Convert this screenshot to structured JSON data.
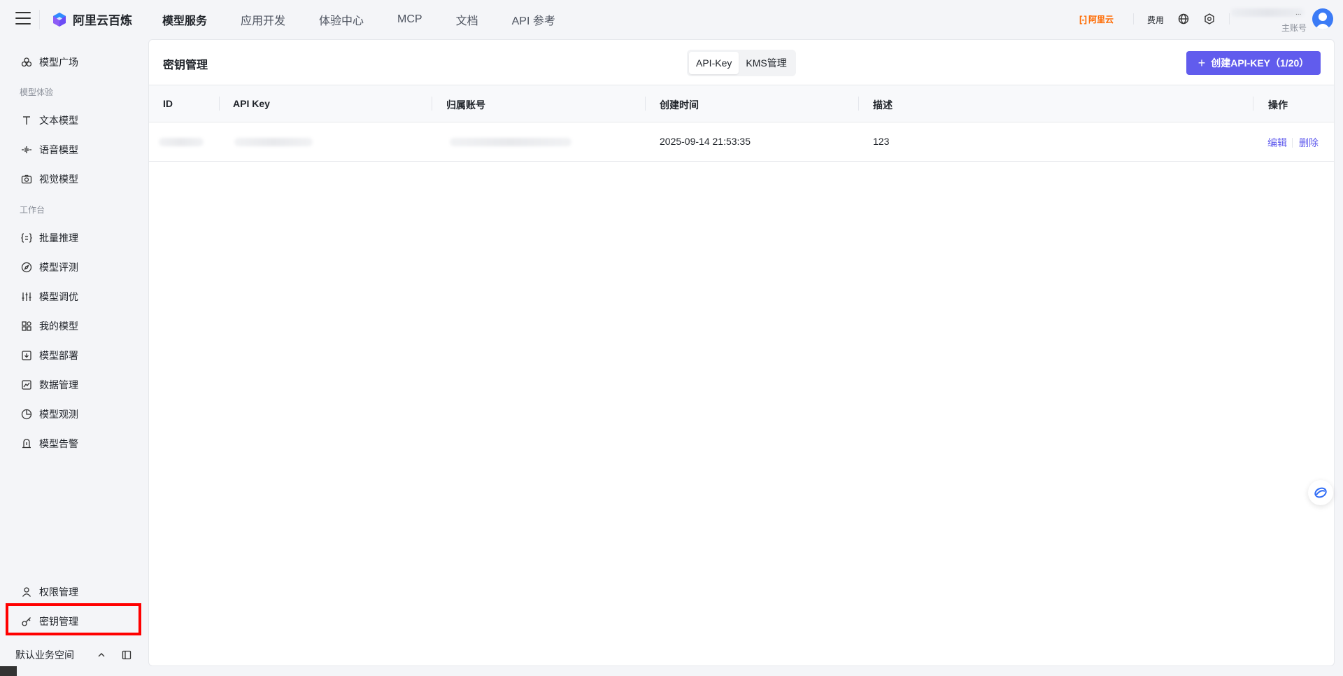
{
  "brand": {
    "name": "阿里云百炼"
  },
  "topnav": [
    {
      "label": "模型服务",
      "active": true
    },
    {
      "label": "应用开发",
      "active": false
    },
    {
      "label": "体验中心",
      "active": false
    },
    {
      "label": "MCP",
      "active": false
    },
    {
      "label": "文档",
      "active": false
    },
    {
      "label": "API 参考",
      "active": false
    }
  ],
  "topright": {
    "aliyun_label": "阿里云",
    "fee_label": "费用",
    "account_dots": "...",
    "account_role": "主账号"
  },
  "sidebar": {
    "item_market": "模型广场",
    "group_experience": "模型体验",
    "item_text": "文本模型",
    "item_voice": "语音模型",
    "item_vision": "视觉模型",
    "group_workbench": "工作台",
    "item_batch": "批量推理",
    "item_eval": "模型评测",
    "item_tune": "模型调优",
    "item_mine": "我的模型",
    "item_deploy": "模型部署",
    "item_data": "数据管理",
    "item_observe": "模型观测",
    "item_alert": "模型告警",
    "item_permission": "权限管理",
    "item_keys": "密钥管理",
    "workspace": "默认业务空间"
  },
  "main": {
    "title": "密钥管理",
    "tabs": [
      {
        "label": "API-Key",
        "active": true
      },
      {
        "label": "KMS管理",
        "active": false
      }
    ],
    "create_button": "创建API-KEY（1/20）",
    "columns": [
      "ID",
      "API Key",
      "归属账号",
      "创建时间",
      "描述",
      "操作"
    ],
    "rows": [
      {
        "created": "2025-09-14 21:53:35",
        "desc": "123",
        "edit": "编辑",
        "delete": "删除"
      }
    ]
  },
  "colors": {
    "accent": "#615ced",
    "aliyun_orange": "#ff6a00",
    "highlight": "#ff0000"
  }
}
